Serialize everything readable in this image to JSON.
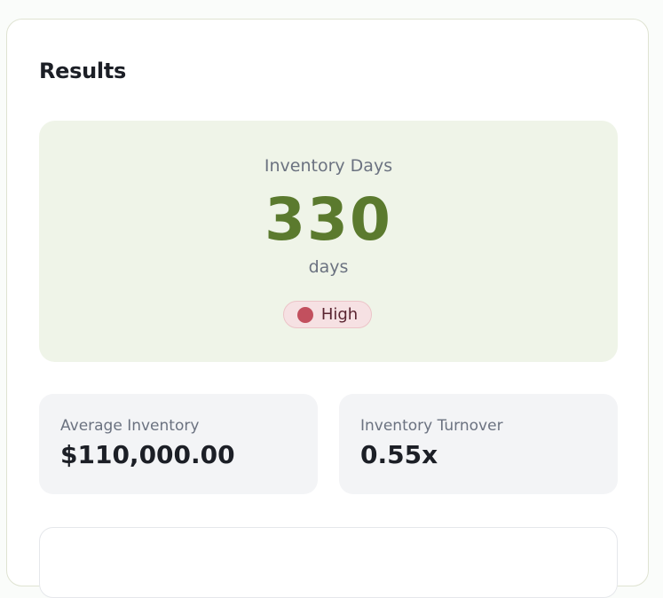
{
  "results": {
    "title": "Results",
    "primary": {
      "label": "Inventory Days",
      "value": "330",
      "unit": "days",
      "status": {
        "label": "High",
        "color": "#c2505e"
      }
    },
    "stats": [
      {
        "label": "Average Inventory",
        "value": "$110,000.00"
      },
      {
        "label": "Inventory Turnover",
        "value": "0.55x"
      }
    ]
  },
  "colors": {
    "accent": "#5b7a2e",
    "hero_bg": "#eff4e8",
    "stat_bg": "#f3f4f6",
    "status_high": "#c2505e"
  }
}
